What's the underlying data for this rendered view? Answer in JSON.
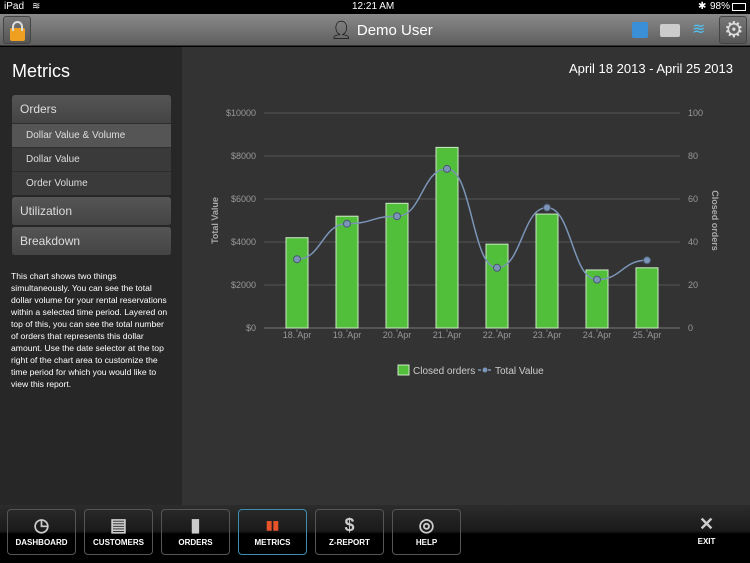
{
  "status": {
    "device": "iPad",
    "time": "12:21 AM",
    "battery": "98%"
  },
  "header": {
    "user": "Demo User"
  },
  "sidebar": {
    "title": "Metrics",
    "groups": [
      {
        "label": "Orders",
        "items": [
          "Dollar Value & Volume",
          "Dollar Value",
          "Order Volume"
        ]
      },
      {
        "label": "Utilization"
      },
      {
        "label": "Breakdown"
      }
    ],
    "description": "This chart shows two things simultaneously. You can see the total dollar volume for your rental reservations within a selected time period. Layered on top of this, you can see the total number of orders that represents this dollar amount. Use the date selector at the top right of the chart area to customize the time period for which you would like to view this report."
  },
  "main": {
    "date_range": "April 18 2013 - April 25 2013"
  },
  "chart_data": {
    "type": "bar",
    "categories": [
      "18. Apr",
      "19. Apr",
      "20. Apr",
      "21. Apr",
      "22. Apr",
      "23. Apr",
      "24. Apr",
      "25. Apr"
    ],
    "series": [
      {
        "name": "Closed orders",
        "type": "bar",
        "axis": "right",
        "color": "#52bf3b",
        "values": [
          42,
          52,
          58,
          84,
          39,
          53,
          27,
          28
        ]
      },
      {
        "name": "Total Value",
        "type": "line",
        "axis": "left",
        "color": "#7b95b8",
        "values": [
          3200,
          4850,
          5200,
          7400,
          2800,
          5600,
          2250,
          3150
        ]
      }
    ],
    "ylabel_left": "Total Value",
    "ylabel_right": "Closed orders",
    "ylim_left": [
      0,
      10000
    ],
    "ylim_right": [
      0,
      100
    ],
    "left_ticks": [
      "$0",
      "$2000",
      "$4000",
      "$6000",
      "$8000",
      "$10000"
    ],
    "right_ticks": [
      "0",
      "20",
      "40",
      "60",
      "80",
      "100"
    ],
    "legend": "bottom",
    "grid": true
  },
  "nav": [
    {
      "label": "DASHBOARD",
      "icon": "◷"
    },
    {
      "label": "CUSTOMERS",
      "icon": "▤"
    },
    {
      "label": "ORDERS",
      "icon": "▮"
    },
    {
      "label": "METRICS",
      "icon": "▮▮"
    },
    {
      "label": "Z-REPORT",
      "icon": "$"
    },
    {
      "label": "HELP",
      "icon": "◎"
    }
  ],
  "exit": {
    "label": "EXIT",
    "icon": "✕"
  }
}
